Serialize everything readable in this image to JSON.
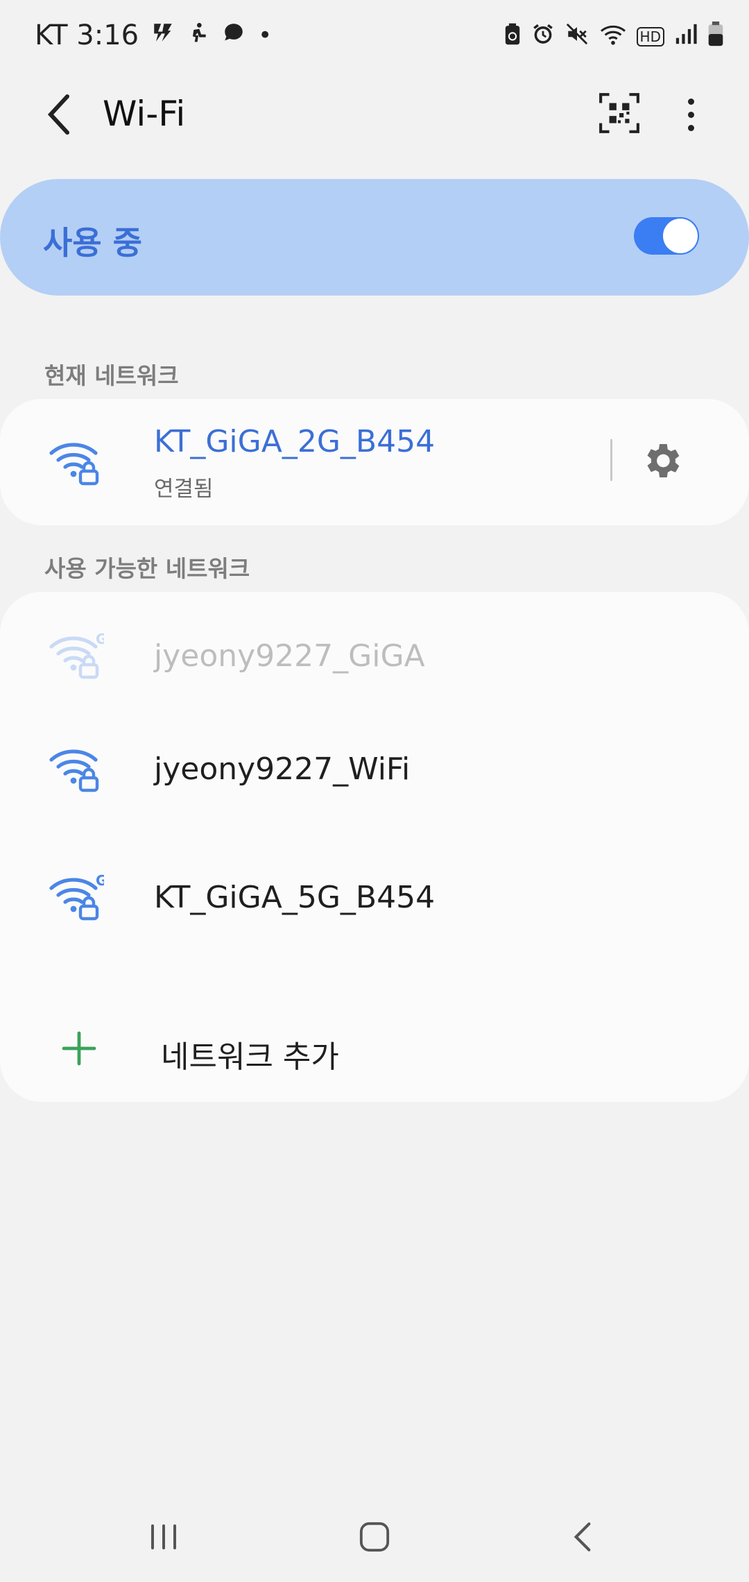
{
  "status_bar": {
    "carrier_time": "KT 3:16",
    "dot": "•",
    "hd_label": "HD"
  },
  "app_bar": {
    "title": "Wi-Fi"
  },
  "master_switch": {
    "label": "사용 중",
    "state": "on"
  },
  "current_network": {
    "header": "현재 네트워크",
    "name": "KT_GiGA_2G_B454",
    "status": "연결됨"
  },
  "available_networks": {
    "header": "사용 가능한 네트워크",
    "items": [
      {
        "name": "jyeony9227_GiGA",
        "band_badge": "G",
        "faded": true
      },
      {
        "name": "jyeony9227_WiFi",
        "band_badge": "",
        "faded": false
      },
      {
        "name": "KT_GiGA_5G_B454",
        "band_badge": "G",
        "faded": false
      }
    ],
    "add_label": "네트워크 추가"
  },
  "colors": {
    "accent": "#3b6fd6",
    "master_bg": "#b3cff5",
    "wifi_icon": "#4b86e6",
    "add_icon": "#3aa35a",
    "background": "#f2f2f2"
  }
}
